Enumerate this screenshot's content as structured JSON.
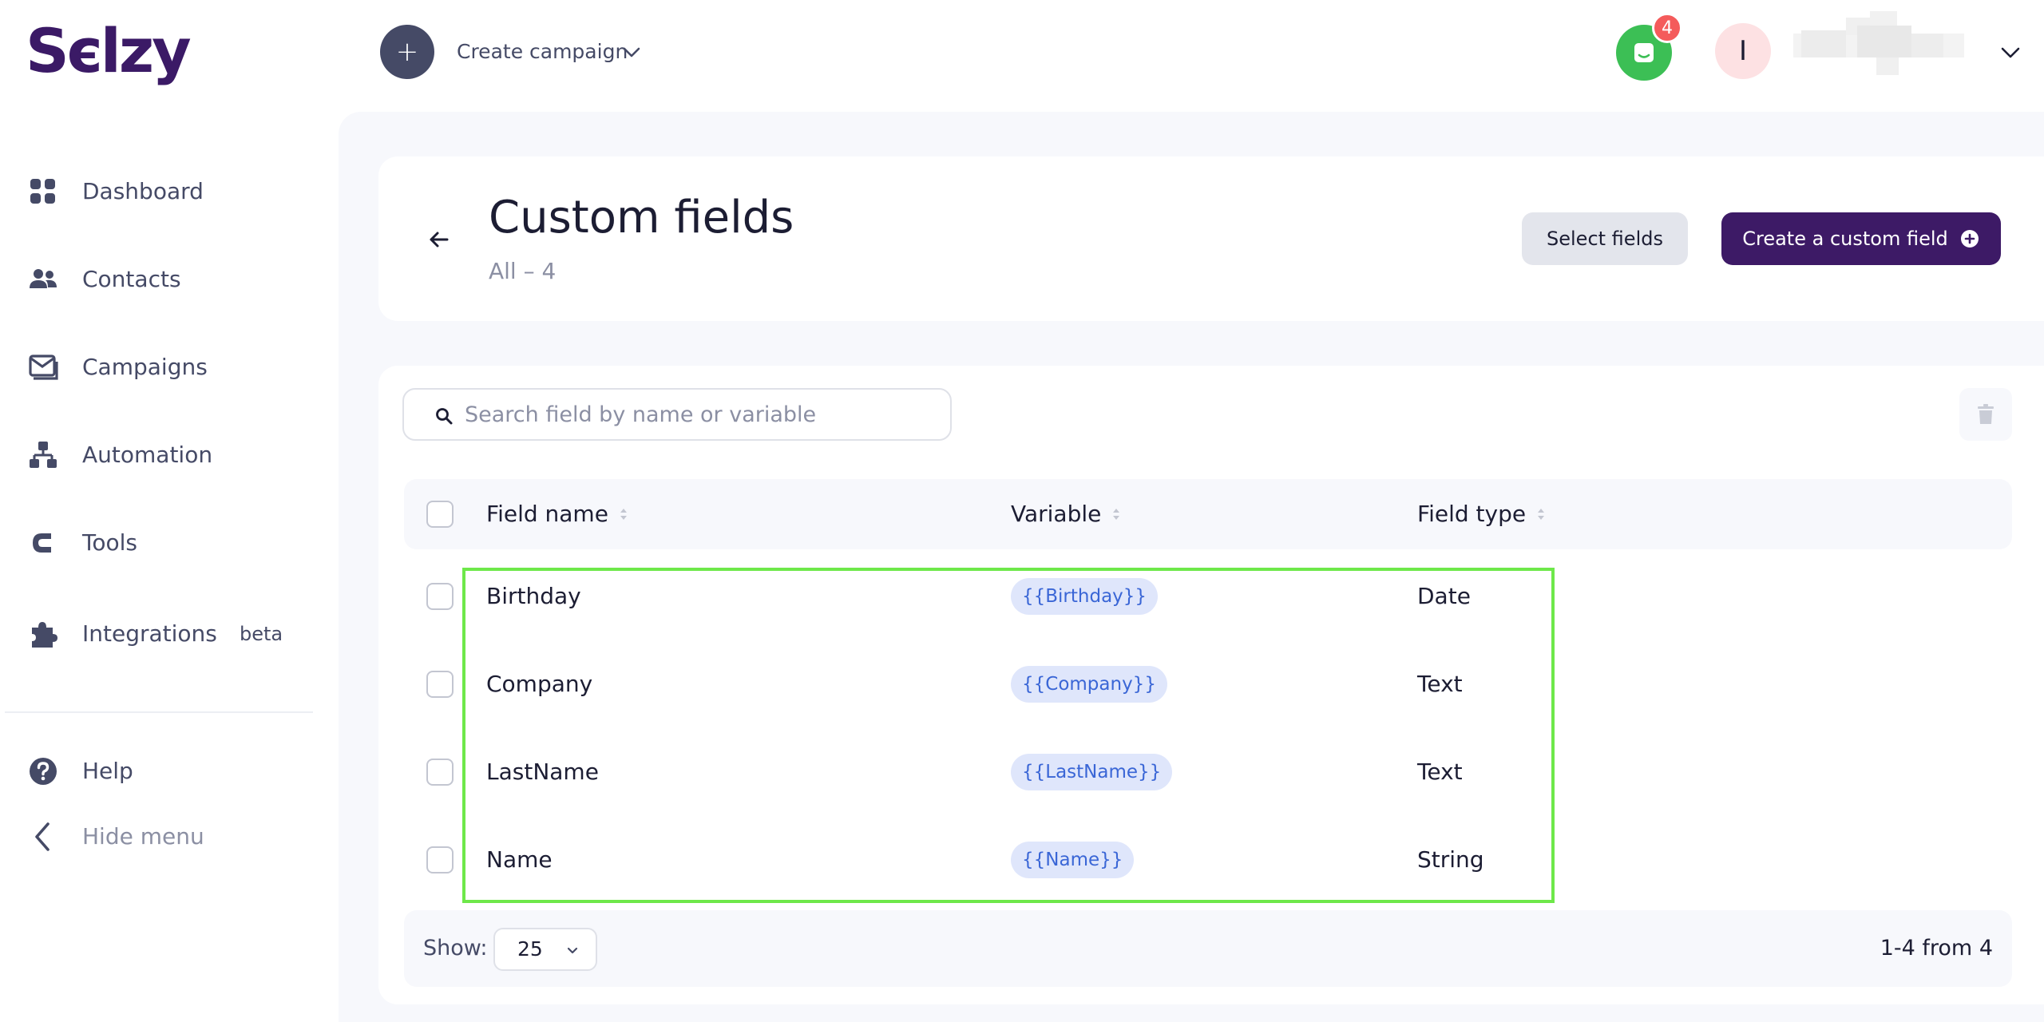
{
  "header": {
    "logo_text": "Sєlzy",
    "create_plus": "+",
    "create_label": "Create campaign",
    "chat_badge": "4",
    "avatar_initial": "I"
  },
  "sidebar": {
    "items": [
      {
        "label": "Dashboard",
        "icon": "dashboard-icon"
      },
      {
        "label": "Contacts",
        "icon": "contacts-icon"
      },
      {
        "label": "Campaigns",
        "icon": "campaigns-icon"
      },
      {
        "label": "Automation",
        "icon": "automation-icon"
      },
      {
        "label": "Tools",
        "icon": "tools-icon"
      },
      {
        "label": "Integrations",
        "icon": "integrations-icon",
        "badge": "beta"
      },
      {
        "label": "Help",
        "icon": "help-icon"
      }
    ],
    "hide_menu": "Hide menu"
  },
  "page": {
    "title": "Custom fields",
    "subtitle": "All – 4",
    "select_fields": "Select fields",
    "create_custom_field": "Create a custom field"
  },
  "search": {
    "placeholder": "Search field by name or variable",
    "value": ""
  },
  "table": {
    "columns": [
      "Field name",
      "Variable",
      "Field type"
    ],
    "rows": [
      {
        "name": "Birthday",
        "variable": "{{Birthday}}",
        "type": "Date"
      },
      {
        "name": "Company",
        "variable": "{{Company}}",
        "type": "Text"
      },
      {
        "name": "LastName",
        "variable": "{{LastName}}",
        "type": "Text"
      },
      {
        "name": "Name",
        "variable": "{{Name}}",
        "type": "String"
      }
    ]
  },
  "footer": {
    "show_label": "Show:",
    "page_size": "25",
    "pagination": "1-4 from 4"
  },
  "colors": {
    "brand": "#3d1a66",
    "accent_green": "#3cbf55",
    "highlight": "#6ee84a",
    "chip_bg": "#dfe6fb",
    "chip_text": "#3a66d6"
  }
}
